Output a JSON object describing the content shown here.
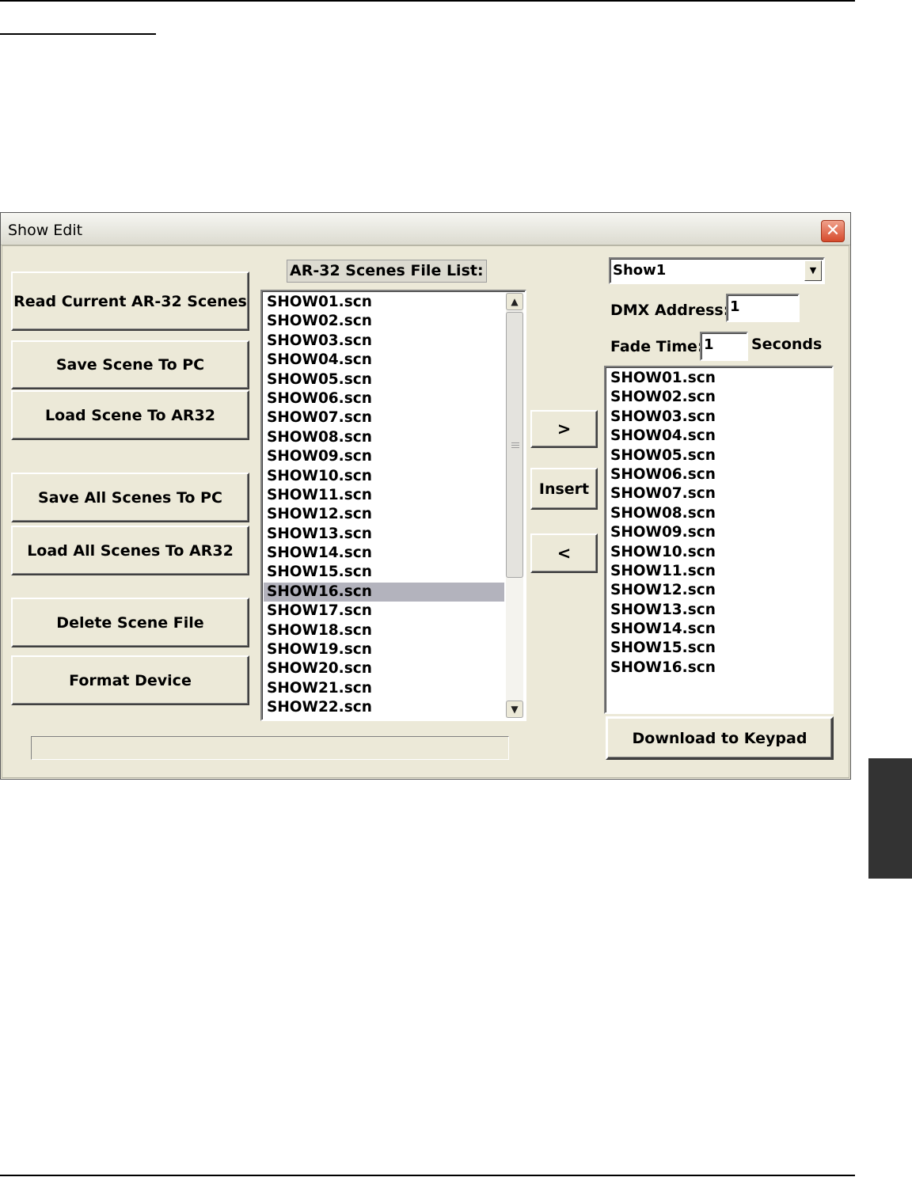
{
  "window": {
    "title": "Show Edit"
  },
  "left_buttons": {
    "read_current": "Read Current AR-32 Scenes",
    "save_scene": "Save Scene To PC",
    "load_scene": "Load Scene To AR32",
    "save_all": "Save All Scenes To PC",
    "load_all": "Load All Scenes To AR32",
    "delete_scene": "Delete Scene File",
    "format_device": "Format Device"
  },
  "scene_list": {
    "label": "AR-32 Scenes File List:",
    "selected": "SHOW16.scn",
    "items": [
      "SHOW01.scn",
      "SHOW02.scn",
      "SHOW03.scn",
      "SHOW04.scn",
      "SHOW05.scn",
      "SHOW06.scn",
      "SHOW07.scn",
      "SHOW08.scn",
      "SHOW09.scn",
      "SHOW10.scn",
      "SHOW11.scn",
      "SHOW12.scn",
      "SHOW13.scn",
      "SHOW14.scn",
      "SHOW15.scn",
      "SHOW16.scn",
      "SHOW17.scn",
      "SHOW18.scn",
      "SHOW19.scn",
      "SHOW20.scn",
      "SHOW21.scn",
      "SHOW22.scn"
    ]
  },
  "transfer_buttons": {
    "add": ">",
    "insert": "Insert",
    "remove": "<"
  },
  "show": {
    "selected": "Show1",
    "dmx_label": "DMX Address:",
    "dmx_value": "1",
    "fade_label": "Fade Time:",
    "fade_value": "1",
    "fade_unit": "Seconds",
    "items": [
      "SHOW01.scn",
      "SHOW02.scn",
      "SHOW03.scn",
      "SHOW04.scn",
      "SHOW05.scn",
      "SHOW06.scn",
      "SHOW07.scn",
      "SHOW08.scn",
      "SHOW09.scn",
      "SHOW10.scn",
      "SHOW11.scn",
      "SHOW12.scn",
      "SHOW13.scn",
      "SHOW14.scn",
      "SHOW15.scn",
      "SHOW16.scn"
    ],
    "download_button": "Download to Keypad"
  },
  "icons": {
    "close": "close-icon",
    "scroll_up": "scroll-up-arrow-icon",
    "scroll_down": "scroll-down-arrow-icon",
    "dropdown": "chevron-down-icon"
  },
  "progress": {
    "value": 0
  }
}
